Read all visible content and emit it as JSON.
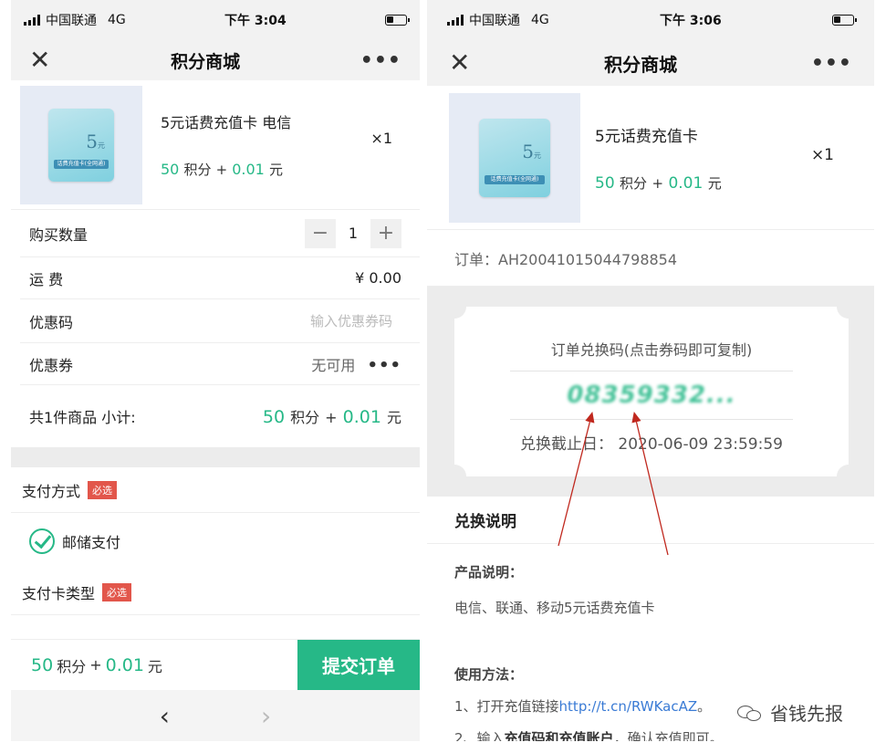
{
  "status_left": {
    "carrier": "中国联通",
    "network": "4G",
    "time": "下午 3:04"
  },
  "status_right": {
    "carrier": "中国联通",
    "network": "4G",
    "time": "下午 3:06"
  },
  "nav": {
    "title": "积分商城",
    "close_glyph": "✕",
    "more_glyph": "•••"
  },
  "checkout": {
    "product": {
      "name": "5元话费充值卡 电信",
      "points": "50",
      "points_unit": "积分",
      "plus": "+",
      "cash": "0.01",
      "cash_unit": "元",
      "qty": "×1"
    },
    "rows": {
      "quantity_label": "购买数量",
      "quantity_value": "1",
      "minus": "−",
      "plus": "+",
      "shipping_label": "运 费",
      "shipping_value": "¥ 0.00",
      "coupon_code_label": "优惠码",
      "coupon_code_placeholder": "输入优惠券码",
      "coupon_label": "优惠券",
      "coupon_value": "无可用",
      "coupon_dots": "•••",
      "subtotal_label": "共1件商品  小计:",
      "subtotal_points": "50",
      "subtotal_points_unit": "积分",
      "subtotal_plus": "+",
      "subtotal_cash": "0.01",
      "subtotal_cash_unit": "元"
    },
    "payment": {
      "method_label": "支付方式",
      "required_badge": "必选",
      "option": "邮储支付",
      "card_type_label": "支付卡类型",
      "card_required_badge": "必选"
    },
    "bottom": {
      "points": "50",
      "points_unit": "积分",
      "plus": "+",
      "cash": "0.01",
      "cash_unit": "元",
      "submit": "提交订单"
    },
    "browser": {
      "back": "‹",
      "forward": "›"
    }
  },
  "order": {
    "product": {
      "name": "5元话费充值卡",
      "points": "50",
      "points_unit": "积分",
      "plus": "+",
      "cash": "0.01",
      "cash_unit": "元",
      "qty": "×1"
    },
    "order_no": "订单：AH20041015044798854",
    "ticket": {
      "title": "订单兑换码(点击券码即可复制)",
      "code": "08359332...",
      "deadline": "兑换截止日：  2020-06-09 23:59:59"
    },
    "instructions": {
      "title": "兑换说明",
      "product_heading": "产品说明：",
      "product_text": "电信、联通、移动5元话费充值卡",
      "usage_heading": "使用方法：",
      "step1_prefix": "1、打开充值链接",
      "step1_link": "http://t.cn/RWKacAZ",
      "step1_suffix": "。",
      "step2_prefix": "2、输入",
      "step2_bold": "充值码和充值账户",
      "step2_suffix": "，确认充值即可。"
    }
  },
  "card_art": {
    "value_text": "5",
    "value_unit": "元",
    "band_text": "话费充值卡(全网通)"
  },
  "watermark": {
    "text": "省钱先报"
  },
  "colors": {
    "accent": "#26b887",
    "badge": "#e2564b",
    "link": "#3a7bd5",
    "arrow": "#c0281e"
  }
}
